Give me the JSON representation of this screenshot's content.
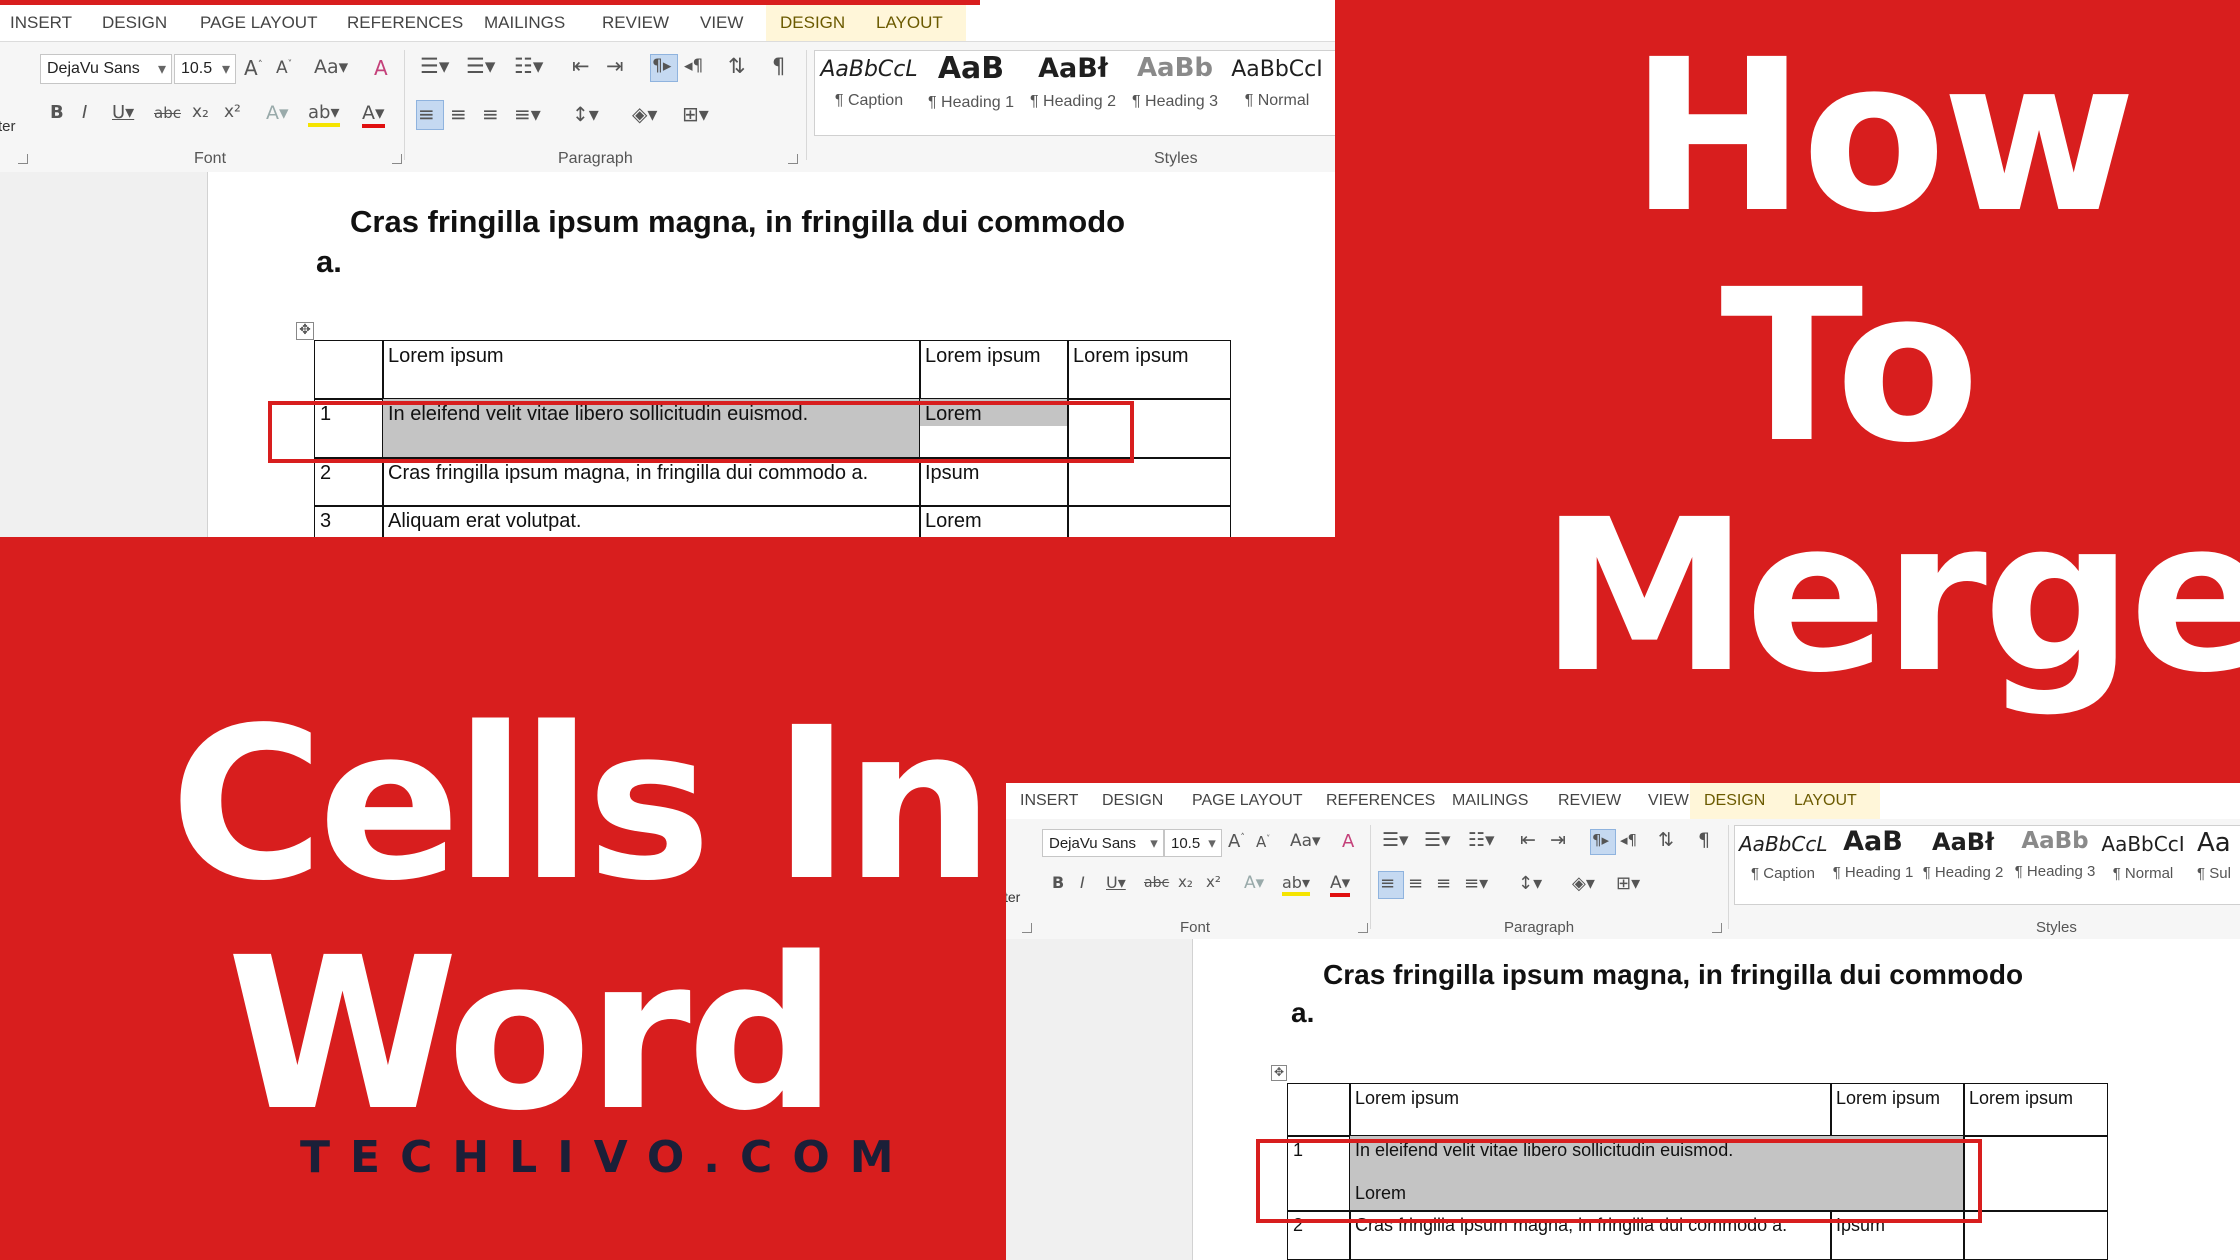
{
  "headline": {
    "how": "How",
    "to": "To",
    "merge": "Merge",
    "cells": "Cells In",
    "word": "Word"
  },
  "brand": "TECHLIVO.COM",
  "colors": {
    "background": "#d81e1e",
    "headline": "#ffffff",
    "brand": "#1b1f38",
    "selection": "#c4c4c4",
    "highlight_box": "#d81e1e"
  },
  "screenshot_before": {
    "tabs": [
      "INSERT",
      "DESIGN",
      "PAGE LAYOUT",
      "REFERENCES",
      "MAILINGS",
      "REVIEW",
      "VIEW",
      "DESIGN",
      "LAYOUT"
    ],
    "left_cut_label": "ter",
    "font": {
      "name": "DejaVu Sans",
      "size": "10.5",
      "case_label": "Aa"
    },
    "groups": {
      "font": "Font",
      "paragraph": "Paragraph",
      "styles": "Styles"
    },
    "styles": [
      {
        "preview": "AaBbCcL",
        "name": "¶ Caption"
      },
      {
        "preview": "AaB",
        "name": "¶ Heading 1"
      },
      {
        "preview": "AaBł",
        "name": "¶ Heading 2"
      },
      {
        "preview": "AaBb",
        "name": "¶ Heading 3"
      },
      {
        "preview": "AaBbCcI",
        "name": "¶ Normal"
      }
    ],
    "doc_title_line1": "Cras fringilla ipsum magna, in fringilla dui commodo",
    "doc_title_line2": "a.",
    "table": {
      "header": [
        "",
        "Lorem ipsum",
        "Lorem ipsum",
        "Lorem ipsum"
      ],
      "row1": [
        "1",
        "In eleifend velit vitae libero sollicitudin euismod.",
        "Lorem",
        ""
      ],
      "row2": [
        "2",
        "Cras fringilla ipsum magna, in fringilla dui commodo a.",
        "Ipsum",
        ""
      ],
      "row3": [
        "3",
        "Aliquam erat volutpat.",
        "Lorem",
        ""
      ]
    }
  },
  "screenshot_after": {
    "tabs": [
      "INSERT",
      "DESIGN",
      "PAGE LAYOUT",
      "REFERENCES",
      "MAILINGS",
      "REVIEW",
      "VIEW",
      "DESIGN",
      "LAYOUT"
    ],
    "left_cut_label": "ter",
    "font": {
      "name": "DejaVu Sans",
      "size": "10.5",
      "case_label": "Aa"
    },
    "groups": {
      "font": "Font",
      "paragraph": "Paragraph",
      "styles": "Styles"
    },
    "styles": [
      {
        "preview": "AaBbCcL",
        "name": "¶ Caption"
      },
      {
        "preview": "AaB",
        "name": "¶ Heading 1"
      },
      {
        "preview": "AaBł",
        "name": "¶ Heading 2"
      },
      {
        "preview": "AaBb",
        "name": "¶ Heading 3"
      },
      {
        "preview": "AaBbCcI",
        "name": "¶ Normal"
      },
      {
        "preview": "Aa",
        "name": "¶ Sul"
      }
    ],
    "doc_title_line1": "Cras fringilla ipsum magna, in fringilla dui commodo",
    "doc_title_line2": "a.",
    "table": {
      "header": [
        "",
        "Lorem ipsum",
        "Lorem ipsum",
        "Lorem ipsum"
      ],
      "row1": {
        "num": "1",
        "merged_line1": "In eleifend velit vitae libero sollicitudin euismod.",
        "merged_line2": "Lorem",
        "last": ""
      },
      "row2": [
        "2",
        "Cras fringilla ipsum magna, in fringilla dui commodo a.",
        "Ipsum",
        ""
      ]
    }
  }
}
